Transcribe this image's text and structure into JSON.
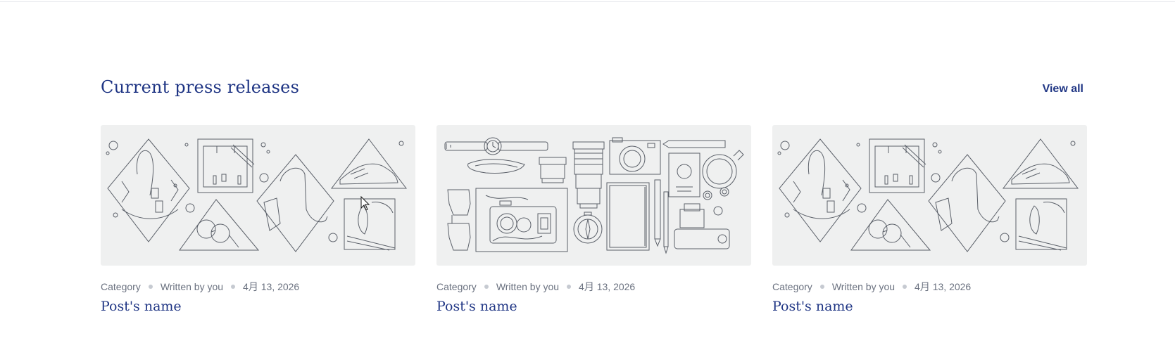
{
  "section": {
    "title": "Current press releases",
    "view_all": "View all"
  },
  "posts": [
    {
      "category": "Category",
      "author": "Written by you",
      "date": "4月 13, 2026",
      "name": "Post's name",
      "image_icon": "fashion-accessories-illustration"
    },
    {
      "category": "Category",
      "author": "Written by you",
      "date": "4月 13, 2026",
      "name": "Post's name",
      "image_icon": "travel-gear-illustration"
    },
    {
      "category": "Category",
      "author": "Written by you",
      "date": "4月 13, 2026",
      "name": "Post's name",
      "image_icon": "fashion-accessories-illustration"
    }
  ],
  "colors": {
    "accent": "#1f3584",
    "meta_text": "#6b7280",
    "thumb_bg": "#eff0f0",
    "line_art": "#5b6069"
  }
}
